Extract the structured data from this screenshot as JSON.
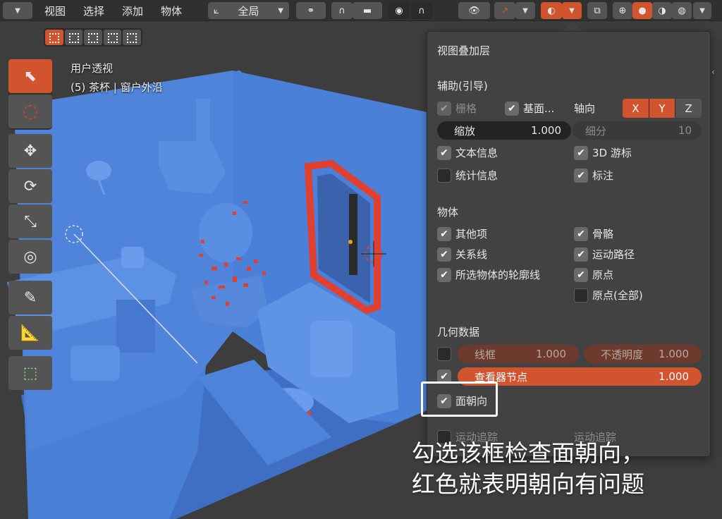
{
  "header": {
    "menus": [
      "视图",
      "选择",
      "添加",
      "物体"
    ],
    "transform_orientation": "全局"
  },
  "viewport": {
    "view_name": "用户透视",
    "object_info": "(5) 茶杯 | 窗户外沿"
  },
  "overlay_panel": {
    "title": "视图叠加层",
    "guides_section": "辅助(引导)",
    "grid_label": "栅格",
    "floor_label": "基面...",
    "axis_label": "轴向",
    "axes": [
      "X",
      "Y",
      "Z"
    ],
    "scale_label": "缩放",
    "scale_value": "1.000",
    "subdiv_label": "细分",
    "subdiv_value": "10",
    "text_info_label": "文本信息",
    "cursor_3d_label": "3D 游标",
    "stats_label": "统计信息",
    "annotations_label": "标注",
    "objects_section": "物体",
    "extras_label": "其他项",
    "bones_label": "骨骼",
    "relationships_label": "关系线",
    "motion_paths_label": "运动路径",
    "outline_label": "所选物体的轮廓线",
    "origins_label": "原点",
    "origins_all_label": "原点(全部)",
    "geometry_section": "几何数据",
    "wireframe_label": "线框",
    "wireframe_value": "1.000",
    "opacity_label": "不透明度",
    "opacity_value": "1.000",
    "viewer_node_label": "查看器节点",
    "viewer_node_value": "1.000",
    "face_orientation_label": "面朝向",
    "motion_tracking_label": "运动追踪",
    "motion_tracking_label2": "运动追踪"
  },
  "annotation": {
    "line1": "勾选该框检查面朝向，",
    "line2": "红色就表明朝向有问题"
  },
  "colors": {
    "accent": "#d2542e",
    "scene_blue": "#4a7fd6",
    "face_red": "#e04030"
  }
}
